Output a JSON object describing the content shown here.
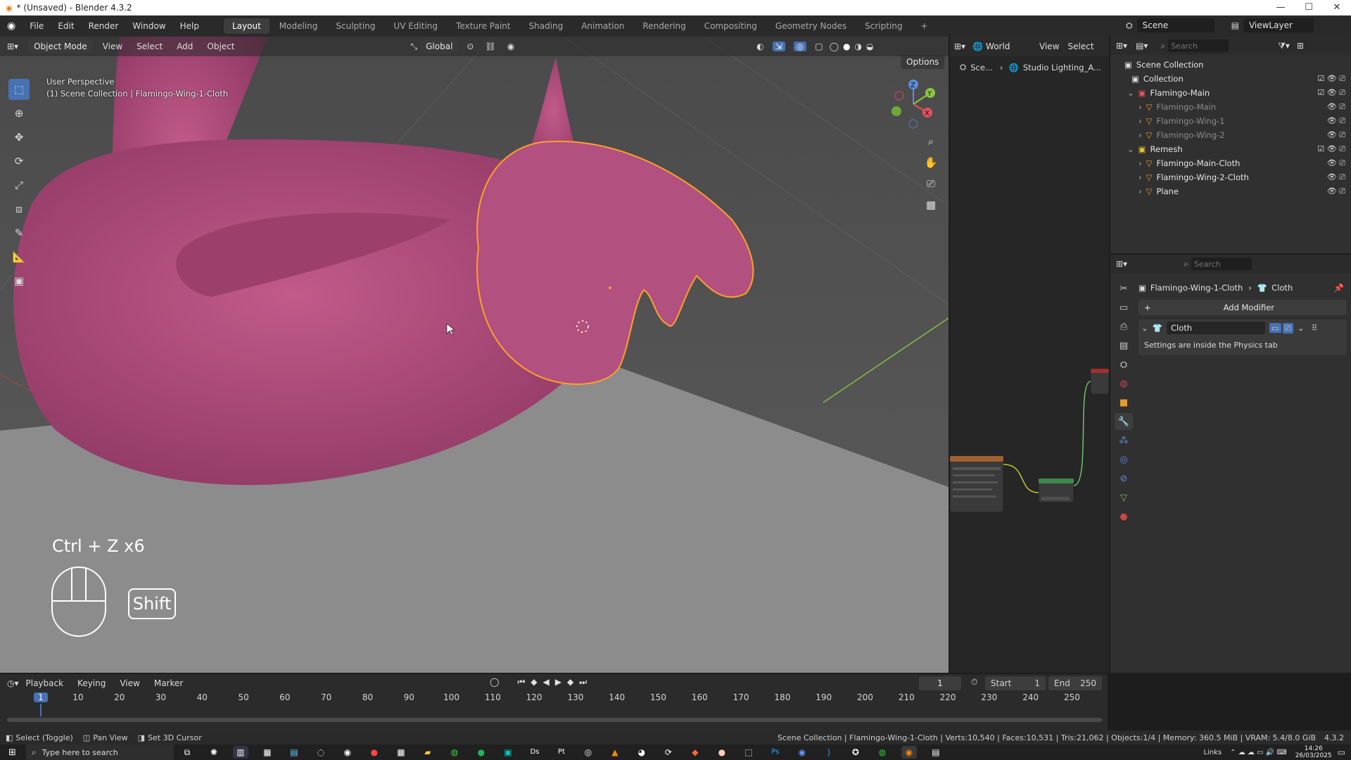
{
  "window": {
    "title": "* (Unsaved) - Blender 4.3.2"
  },
  "menu": [
    "File",
    "Edit",
    "Render",
    "Window",
    "Help"
  ],
  "workspaces": [
    "Layout",
    "Modeling",
    "Sculpting",
    "UV Editing",
    "Texture Paint",
    "Shading",
    "Animation",
    "Rendering",
    "Compositing",
    "Geometry Nodes",
    "Scripting",
    "+"
  ],
  "active_workspace": "Layout",
  "scene": {
    "name": "Scene",
    "view_layer": "ViewLayer"
  },
  "viewport": {
    "mode": "Object Mode",
    "menus": [
      "View",
      "Select",
      "Add",
      "Object"
    ],
    "transform_orientation": "Global",
    "options_label": "Options",
    "perspective_label": "User Perspective",
    "collection_label": "(1) Scene Collection | Flamingo-Wing-1-Cloth",
    "shortcut_text": "Ctrl + Z x6",
    "key_label": "Shift",
    "gizmo": {
      "z": "Z",
      "y": "Y",
      "x": "X"
    }
  },
  "node_editor": {
    "world_label": "World",
    "menus": [
      "View",
      "Select"
    ],
    "breadcrumb_scene": "Sce...",
    "breadcrumb_world": "Studio Lighting_A..."
  },
  "outliner": {
    "search_placeholder": "Search",
    "root": "Scene Collection",
    "items": [
      {
        "label": "Collection",
        "indent": 0,
        "dim": false
      },
      {
        "label": "Flamingo-Main",
        "indent": 0,
        "dim": false
      },
      {
        "label": "Flamingo-Main",
        "indent": 1,
        "dim": true
      },
      {
        "label": "Flamingo-Wing-1",
        "indent": 1,
        "dim": true
      },
      {
        "label": "Flamingo-Wing-2",
        "indent": 1,
        "dim": true
      },
      {
        "label": "Remesh",
        "indent": 0,
        "dim": false
      },
      {
        "label": "Flamingo-Main-Cloth",
        "indent": 1,
        "dim": false
      },
      {
        "label": "Flamingo-Wing-2-Cloth",
        "indent": 1,
        "dim": false
      },
      {
        "label": "Plane",
        "indent": 1,
        "dim": false
      }
    ]
  },
  "properties": {
    "search_placeholder": "Search",
    "breadcrumb_object": "Flamingo-Wing-1-Cloth",
    "breadcrumb_modifier": "Cloth",
    "add_modifier_label": "Add Modifier",
    "modifier_name": "Cloth",
    "modifier_note": "Settings are inside the Physics tab"
  },
  "timeline": {
    "menus": [
      "Playback",
      "Keying",
      "View",
      "Marker"
    ],
    "current_frame": "1",
    "start_label": "Start",
    "start_value": "1",
    "end_label": "End",
    "end_value": "250",
    "ticks": [
      "1",
      "10",
      "20",
      "30",
      "40",
      "50",
      "60",
      "70",
      "80",
      "90",
      "100",
      "110",
      "120",
      "130",
      "140",
      "150",
      "160",
      "170",
      "180",
      "190",
      "200",
      "210",
      "220",
      "230",
      "240",
      "250"
    ]
  },
  "statusbar": {
    "select": "Select (Toggle)",
    "pan": "Pan View",
    "cursor": "Set 3D Cursor",
    "info": "Scene Collection | Flamingo-Wing-1-Cloth | Verts:10,540 | Faces:10,531 | Tris:21,062 | Objects:1/4 | Memory: 360.5 MiB | VRAM: 5.4/8.0 GiB",
    "version": "4.3.2"
  },
  "taskbar": {
    "search_placeholder": "Type here to search",
    "links": "Links",
    "time": "14:26",
    "date": "26/03/2025"
  },
  "colors": {
    "accent": "#4772b3",
    "selection": "#ffa028",
    "flamingo": "#b04a78",
    "viewport": "#5a5a5a"
  }
}
